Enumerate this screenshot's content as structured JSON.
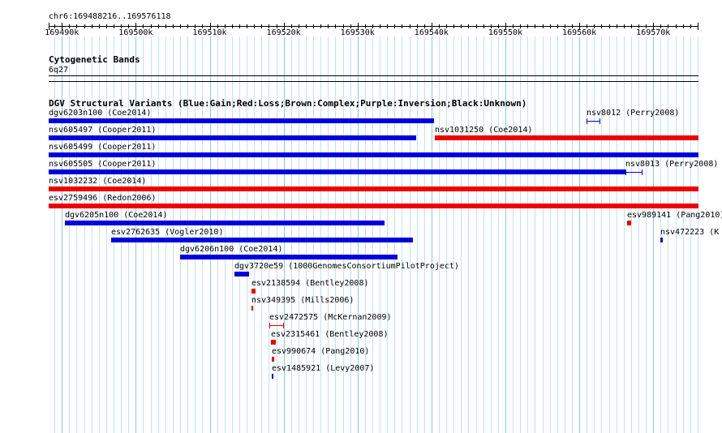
{
  "browser": {
    "region_label": "chr6:169488216..169576118",
    "range": [
      169488216,
      169576118
    ],
    "ruler_ticks": [
      {
        "pos": 169490000,
        "label": "169490k"
      },
      {
        "pos": 169500000,
        "label": "169500k"
      },
      {
        "pos": 169510000,
        "label": "169510k"
      },
      {
        "pos": 169520000,
        "label": "169520k"
      },
      {
        "pos": 169530000,
        "label": "169530k"
      },
      {
        "pos": 169540000,
        "label": "169540k"
      },
      {
        "pos": 169550000,
        "label": "169550k"
      },
      {
        "pos": 169560000,
        "label": "169560k"
      },
      {
        "pos": 169570000,
        "label": "169570k"
      }
    ]
  },
  "cytoband_track": {
    "title": "Cytogenetic Bands",
    "band_label": "6q27"
  },
  "dgv_track": {
    "title": "DGV Structural Variants (Blue:Gain;Red:Loss;Brown:Complex;Purple:Inversion;Black:Unknown)",
    "colors": {
      "gain": "#0000dd",
      "loss": "#ee0000"
    },
    "features": [
      {
        "label": "dgv6203n100 (Coe2014)",
        "start": 169488216,
        "end": 169540300,
        "type": "gain",
        "row": 0,
        "style": "bar"
      },
      {
        "label": "nsv8012 (Perry2008)",
        "start": 169561000,
        "end": 169562800,
        "type": "gain",
        "row": 0,
        "style": "range"
      },
      {
        "label": "nsv605497 (Cooper2011)",
        "start": 169488216,
        "end": 169537900,
        "type": "gain",
        "row": 1,
        "style": "bar"
      },
      {
        "label": "nsv1031250 (Coe2014)",
        "start": 169540400,
        "end": 169576118,
        "type": "loss",
        "row": 1,
        "style": "bar"
      },
      {
        "label": "nsv605499 (Cooper2011)",
        "start": 169488216,
        "end": 169576118,
        "type": "gain",
        "row": 2,
        "style": "bar"
      },
      {
        "label": "nsv605505 (Cooper2011)",
        "start": 169488216,
        "end": 169566200,
        "type": "gain",
        "row": 3,
        "style": "bar"
      },
      {
        "label": "nsv8013 (Perry2008)",
        "start": 169566200,
        "end": 169568600,
        "type": "gain",
        "row": 3,
        "style": "range"
      },
      {
        "label": "nsv1032232 (Coe2014)",
        "start": 169488216,
        "end": 169576118,
        "type": "loss",
        "row": 4,
        "style": "bar"
      },
      {
        "label": "esv2759496 (Redon2006)",
        "start": 169488216,
        "end": 169576118,
        "type": "loss",
        "row": 5,
        "style": "bar"
      },
      {
        "label": "dgv6205n100 (Coe2014)",
        "start": 169490400,
        "end": 169533600,
        "type": "gain",
        "row": 6,
        "style": "bar"
      },
      {
        "label": "esv989141 (Pang2010)",
        "start": 169566500,
        "end": 169567000,
        "type": "loss",
        "row": 6,
        "style": "bar"
      },
      {
        "label": "nsv472223 (K",
        "start": 169571000,
        "end": 169571300,
        "type": "gain",
        "row": 7,
        "style": "bar"
      },
      {
        "label": "esv2762635 (Vogler2010)",
        "start": 169496700,
        "end": 169537500,
        "type": "gain",
        "row": 7,
        "style": "bar"
      },
      {
        "label": "dgv6206n100 (Coe2014)",
        "start": 169506000,
        "end": 169535400,
        "type": "gain",
        "row": 8,
        "style": "bar"
      },
      {
        "label": "dgv3720e59 (1000GenomesConsortiumPilotProject)",
        "start": 169513400,
        "end": 169515300,
        "type": "gain",
        "row": 9,
        "style": "bar"
      },
      {
        "label": "esv2138594 (Bentley2008)",
        "start": 169515600,
        "end": 169516200,
        "type": "loss",
        "row": 10,
        "style": "bar"
      },
      {
        "label": "nsv349395 (Mills2006)",
        "start": 169515600,
        "end": 169515900,
        "type": "loss",
        "row": 11,
        "style": "bar"
      },
      {
        "label": "esv2472575 (McKernan2009)",
        "start": 169518100,
        "end": 169520000,
        "type": "loss",
        "row": 12,
        "style": "range"
      },
      {
        "label": "esv2315461 (Bentley2008)",
        "start": 169518300,
        "end": 169518900,
        "type": "loss",
        "row": 13,
        "style": "bar"
      },
      {
        "label": "esv990674 (Pang2010)",
        "start": 169518400,
        "end": 169518700,
        "type": "loss",
        "row": 14,
        "style": "bar"
      },
      {
        "label": "esv1485921 (Levy2007)",
        "start": 169518400,
        "end": 169518600,
        "type": "gain",
        "row": 15,
        "style": "bar"
      }
    ]
  }
}
